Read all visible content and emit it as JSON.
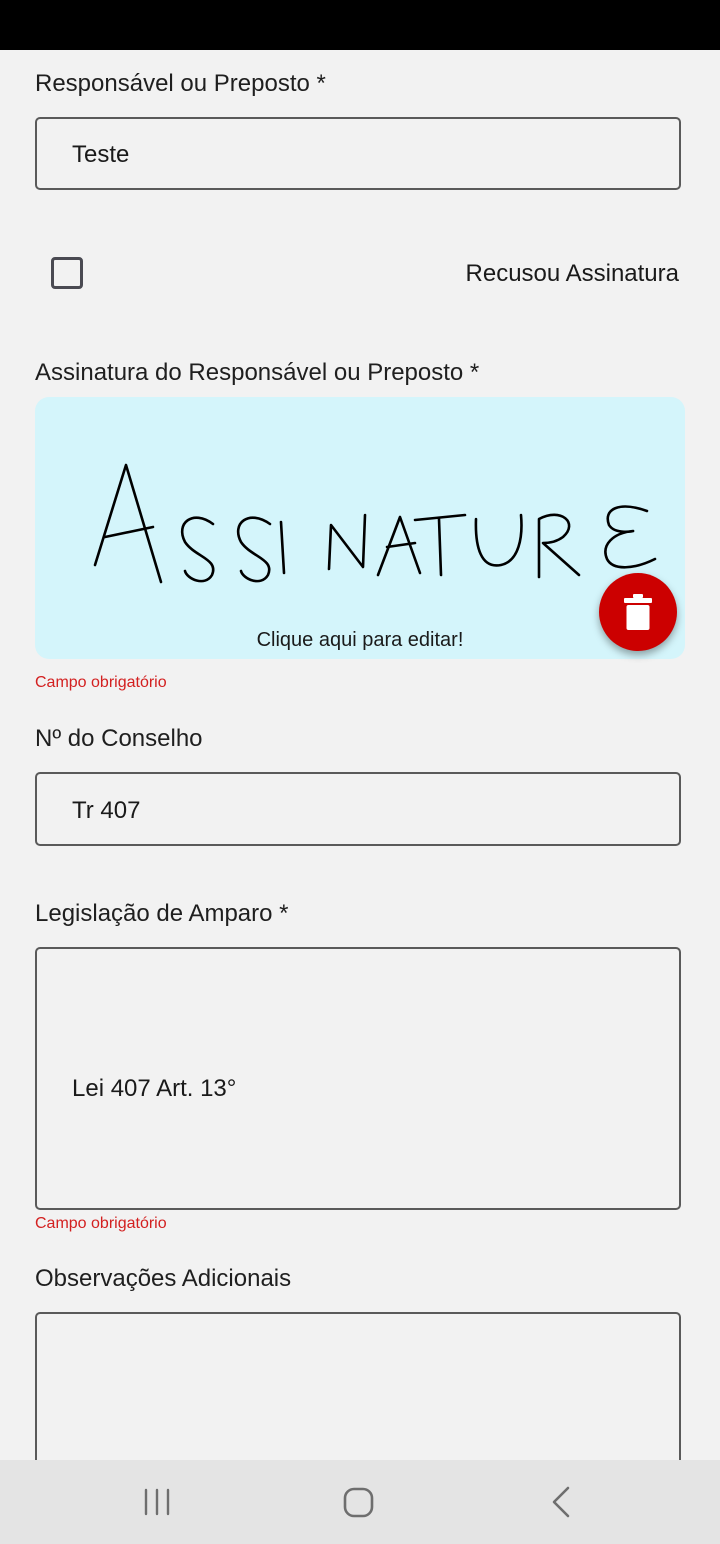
{
  "form": {
    "responsavel": {
      "label": "Responsável ou Preposto *",
      "value": "Teste"
    },
    "recusou": {
      "label": "Recusou Assinatura",
      "checked": false
    },
    "assinatura": {
      "label": "Assinatura do Responsável ou Preposto *",
      "hint": "Clique aqui para editar!",
      "error": "Campo obrigatório",
      "background": "#d4f5fb",
      "delete_icon": "trash-icon",
      "delete_color": "#cc0000"
    },
    "conselho": {
      "label": "Nº do Conselho",
      "value": "Tr 407"
    },
    "legislacao": {
      "label": "Legislação de Amparo *",
      "value": "Lei 407 Art. 13°",
      "error": "Campo obrigatório"
    },
    "observacoes": {
      "label": "Observações Adicionais",
      "value": ""
    }
  },
  "error_color": "#d32020",
  "navbar": {
    "recent_icon": "recent-apps-icon",
    "home_icon": "home-icon",
    "back_icon": "back-icon"
  }
}
